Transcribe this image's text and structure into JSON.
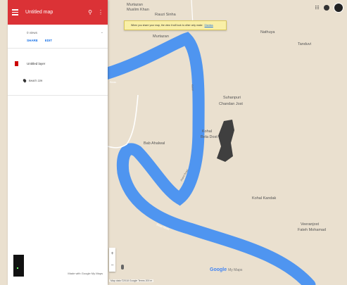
{
  "colors": {
    "header": "#db3236",
    "river": "#4f95f0",
    "land": "#eae0cf",
    "boundary": "#3f3f3f",
    "road": "#ffffff",
    "link": "#1a73e8"
  },
  "panel": {
    "title": "Untitled map",
    "views": "0 views",
    "share": "SHARE",
    "edit": "EDIT",
    "layer_title": "Untitled layer",
    "place_label": "BHATI 229",
    "credit": "Made with Google My Maps"
  },
  "notice": {
    "text": "When you share your map, the view it will look to other only make",
    "dismiss": "Dismiss"
  },
  "map_labels": {
    "murtazan_top": "Murtazan",
    "muslim_khan": "Muslim Khan",
    "rauzi_sinha": "Rauzi Sinha",
    "murtazan_mid": "Murtazan",
    "nathuya": "Nathuya",
    "tanduvi": "Tanduvi",
    "suhanpuri": "Suhanpuri",
    "chandan_jost": "Chandan Jost",
    "kohal": "Kohal",
    "bela_dost": "Bela Dost",
    "bab_ahalwal": "Bab Ahalwal",
    "kohal_kandak": "Kohal Kandak",
    "veeran_jost": "Veeranjost",
    "fateh_mohamad": "Fateh Mohamad",
    "river_left": "Beas",
    "river_bottom": "Beas River",
    "road_left": "Karan",
    "road_mid": "Jhand Road"
  },
  "controls": {
    "zoom_in": "+",
    "zoom_out": "−",
    "logo": "Google",
    "my_maps": "My Maps",
    "attribution": "Map data ©2018 Google  Terms  200 m"
  },
  "icons": {
    "menu": "hamburger-icon",
    "search": "search-icon",
    "more": "more-vert-icon",
    "apps": "apps-grid-icon",
    "notifications": "bell-icon",
    "account": "avatar",
    "pegman": "pegman-icon"
  }
}
